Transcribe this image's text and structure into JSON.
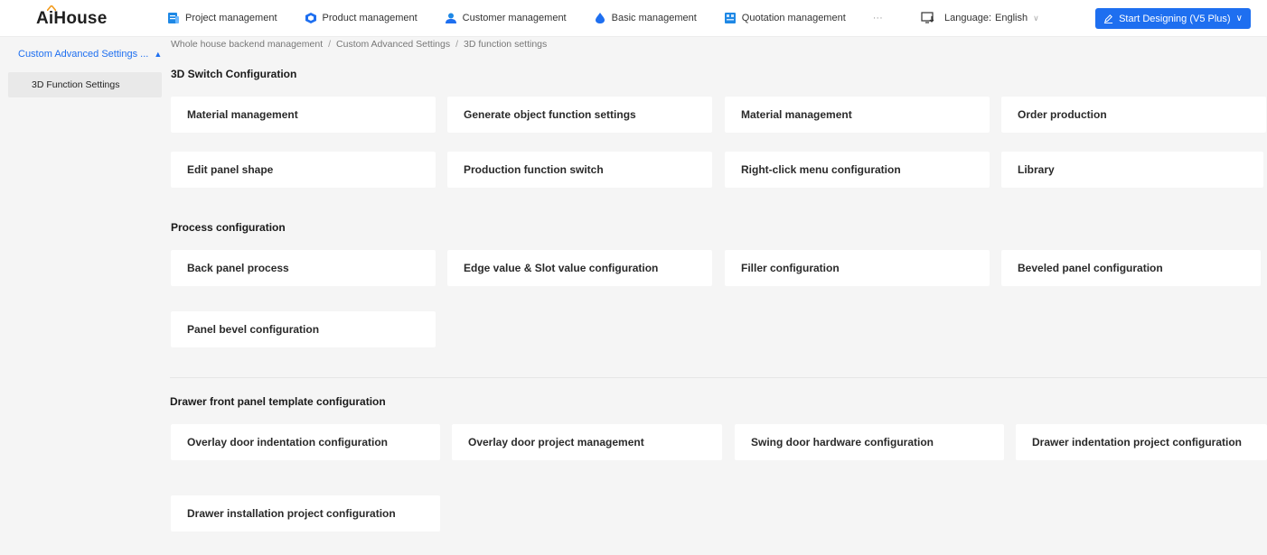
{
  "app": {
    "logo": "AiHouse"
  },
  "topnav": {
    "items": [
      {
        "label": "Project management",
        "icon": "folder-icon",
        "color": "#1e88e5"
      },
      {
        "label": "Product management",
        "icon": "cube-icon",
        "color": "#1e6ff0"
      },
      {
        "label": "Customer management",
        "icon": "user-icon",
        "color": "#1e88e5"
      },
      {
        "label": "Basic management",
        "icon": "drop-icon",
        "color": "#1e6ff0"
      },
      {
        "label": "Quotation management",
        "icon": "quotation-icon",
        "color": "#1e88e5"
      }
    ],
    "more": "···"
  },
  "language": {
    "label": "Language:",
    "value": "English"
  },
  "start_button": {
    "label": "Start Designing (V5 Plus)"
  },
  "sidebar": {
    "group_label": "Custom Advanced Settings ...",
    "item_label": "3D Function Settings"
  },
  "breadcrumb": [
    "Whole house backend management",
    "Custom Advanced Settings",
    "3D function settings"
  ],
  "sections": [
    {
      "title": "3D Switch Configuration",
      "cards": [
        "Material management",
        "Generate object function settings",
        "Material management",
        "Order production",
        "Edit panel shape",
        "Production function switch",
        "Right-click menu configuration",
        "Library"
      ]
    },
    {
      "title": "Process configuration",
      "cards": [
        "Back panel process",
        "Edge value & Slot value configuration",
        "Filler configuration",
        "Beveled panel configuration",
        "Panel bevel configuration"
      ]
    },
    {
      "title": "Drawer front panel template configuration",
      "cards": [
        "Overlay door indentation configuration",
        "Overlay door project management",
        "Swing door hardware configuration",
        "Drawer indentation project configuration",
        "Drawer installation project configuration"
      ]
    }
  ],
  "colors": {
    "accent": "#1e6ff0",
    "background": "#f5f5f5",
    "card": "#ffffff"
  }
}
